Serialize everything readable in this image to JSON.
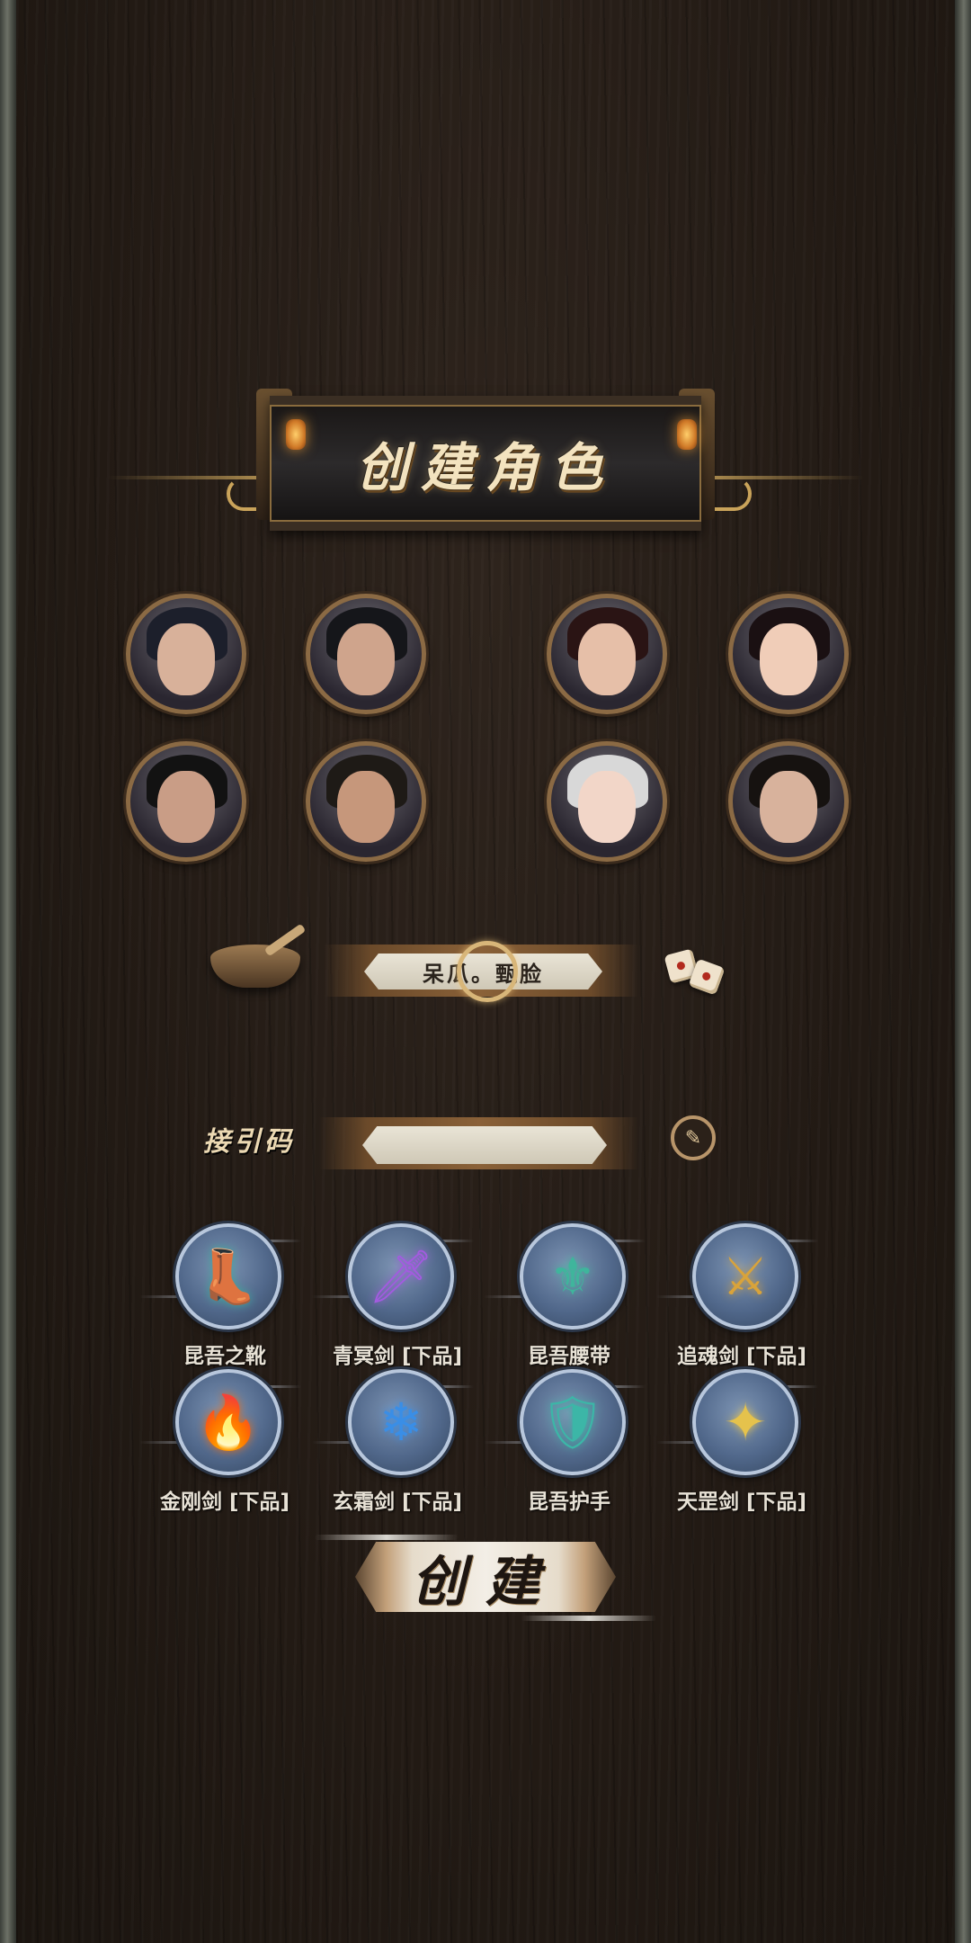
{
  "title": "创建角色",
  "avatars": [
    {
      "label": "male-1",
      "skin": "#d8b19a",
      "hair": "#1c1f2b"
    },
    {
      "label": "male-2",
      "skin": "#cfa48c",
      "hair": "#15161a"
    },
    {
      "label": "female-1",
      "skin": "#e6bfa8",
      "hair": "#2a1414"
    },
    {
      "label": "female-2",
      "skin": "#f0cdb8",
      "hair": "#1a1012"
    },
    {
      "label": "male-3",
      "skin": "#c99d86",
      "hair": "#121212"
    },
    {
      "label": "male-4",
      "skin": "#c6977b",
      "hair": "#1e1a16"
    },
    {
      "label": "female-3",
      "skin": "#f2d6c8",
      "hair": "#d8d8d8"
    },
    {
      "label": "female-4",
      "skin": "#d8b29c",
      "hair": "#161210"
    }
  ],
  "name_field": {
    "value": "呆瓜。甄脸"
  },
  "invite": {
    "label": "接引码",
    "value": "",
    "placeholder": ""
  },
  "items": [
    {
      "name": "昆吾之靴",
      "icon": "boots-icon",
      "glyph": "👢",
      "color": "#3ea89b"
    },
    {
      "name": "青冥剑 [下品]",
      "icon": "purple-sword-icon",
      "glyph": "🗡",
      "color": "#a35be0"
    },
    {
      "name": "昆吾腰带",
      "icon": "belt-icon",
      "glyph": "⚜",
      "color": "#3fb59c"
    },
    {
      "name": "追魂剑 [下品]",
      "icon": "gold-sword-icon",
      "glyph": "⚔",
      "color": "#d9a33a"
    },
    {
      "name": "金刚剑 [下品]",
      "icon": "flame-sword-icon",
      "glyph": "🔥",
      "color": "#e06d1e"
    },
    {
      "name": "玄霜剑 [下品]",
      "icon": "frost-sword-icon",
      "glyph": "❄",
      "color": "#3a8ee6"
    },
    {
      "name": "昆吾护手",
      "icon": "gauntlet-icon",
      "glyph": "🛡",
      "color": "#3cb6a7"
    },
    {
      "name": "天罡剑 [下品]",
      "icon": "golden-blade-icon",
      "glyph": "✦",
      "color": "#e5c24c"
    }
  ],
  "create_button": "创建"
}
